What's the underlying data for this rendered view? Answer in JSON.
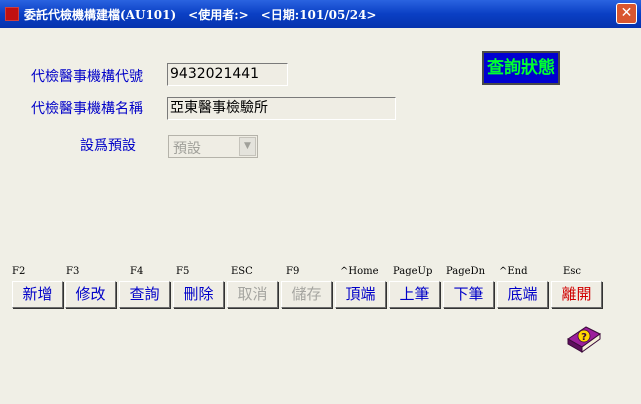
{
  "window": {
    "title": "委託代檢機構建檔(AU101)　<使用者:>　<日期:101/05/24>",
    "close_symbol": "✕"
  },
  "form": {
    "code_label": "代檢醫事機構代號",
    "code_value": "9432021441",
    "name_label": "代檢醫事機構名稱",
    "name_value": "亞東醫事檢驗所",
    "default_label": "設爲預設",
    "default_value": "預設"
  },
  "status_button": {
    "label": "查詢狀態",
    "text_color": "#00ff30",
    "bg_color": "#0000d0"
  },
  "toolbar": [
    {
      "key": "F2",
      "label": "新增",
      "state": "enabled"
    },
    {
      "key": "F3",
      "label": "修改",
      "state": "enabled"
    },
    {
      "key": "F4",
      "label": "查詢",
      "state": "enabled"
    },
    {
      "key": "F5",
      "label": "刪除",
      "state": "enabled"
    },
    {
      "key": "ESC",
      "label": "取消",
      "state": "disabled"
    },
    {
      "key": "F9",
      "label": "儲存",
      "state": "disabled"
    },
    {
      "key": "^Home",
      "label": "頂端",
      "state": "enabled"
    },
    {
      "key": "PageUp",
      "label": "上筆",
      "state": "enabled"
    },
    {
      "key": "PageDn",
      "label": "下筆",
      "state": "enabled"
    },
    {
      "key": "^End",
      "label": "底端",
      "state": "enabled"
    },
    {
      "key": "Esc",
      "label": "離開",
      "state": "exit"
    }
  ],
  "help_button": {
    "icon": "help-book-icon"
  },
  "colors": {
    "label": "#0000c8",
    "exit": "#d00000",
    "titlebar": "#0a3fc4"
  }
}
